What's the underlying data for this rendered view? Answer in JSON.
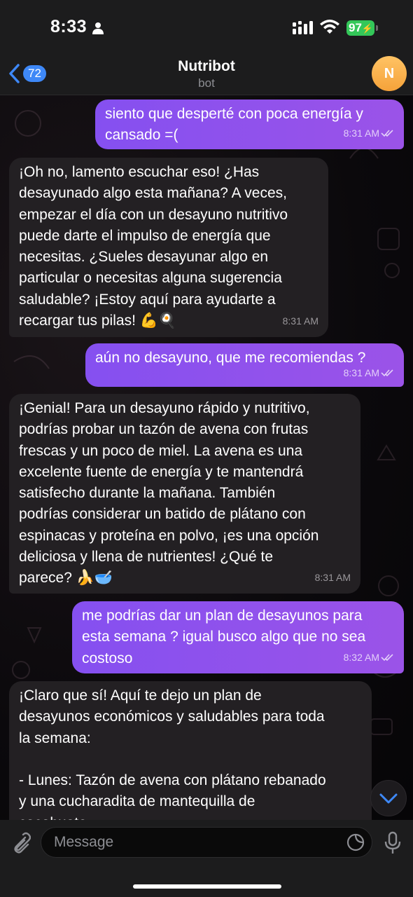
{
  "status_bar": {
    "time": "8:33",
    "battery": "97"
  },
  "header": {
    "back_count": "72",
    "title": "Nutribot",
    "subtitle": "bot",
    "avatar_letter": "N"
  },
  "messages": [
    {
      "direction": "out",
      "text": "siento que desperté con poca energía y\ncansado =(",
      "time": "8:31 AM"
    },
    {
      "direction": "in",
      "text": "¡Oh no, lamento escuchar eso! ¿Has\ndesayunado algo esta mañana? A veces,\nempezar el día con un desayuno nutritivo\npuede darte el impulso de energía que\nnecesitas. ¿Sueles desayunar algo en\nparticular o necesitas alguna sugerencia\nsaludable? ¡Estoy aquí para ayudarte a\nrecargar tus pilas! 💪🍳",
      "time": "8:31 AM"
    },
    {
      "direction": "out",
      "text": "aún no desayuno, que me recomiendas ?",
      "time": "8:31 AM"
    },
    {
      "direction": "in",
      "text": "¡Genial! Para un desayuno rápido y nutritivo,\npodrías probar un tazón de avena con frutas\nfrescas y un poco de miel. La avena es una\nexcelente fuente de energía y te mantendrá\nsatisfecho durante la mañana. También\npodrías considerar un batido de plátano con\nespinacas y proteína en polvo, ¡es una opción\ndeliciosa y llena de nutrientes! ¿Qué te\nparece? 🍌🥣",
      "time": "8:31 AM"
    },
    {
      "direction": "out",
      "text": "me podrías dar un plan de desayunos para\nesta semana ? igual busco algo que no sea\ncostoso",
      "time": "8:32 AM"
    },
    {
      "direction": "in",
      "text": "¡Claro que sí! Aquí te dejo un plan de\ndesayunos económicos y saludables para toda\nla semana:\n\n- Lunes: Tazón de avena con plátano rebanado\ny una cucharadita de mantequilla de\ncacahuate",
      "time": ""
    }
  ],
  "input": {
    "placeholder": "Message"
  },
  "icons": {
    "back": "chevron-left-icon",
    "attach": "paperclip-icon",
    "sticker": "sticker-icon",
    "mic": "microphone-icon",
    "scroll": "chevron-down-icon",
    "read": "double-check-icon"
  },
  "colors": {
    "outgoing_bubble": "#8f52ee",
    "incoming_bubble": "#232023",
    "accent": "#3e88f7",
    "battery": "#34c759",
    "avatar": "#f5a23a"
  }
}
